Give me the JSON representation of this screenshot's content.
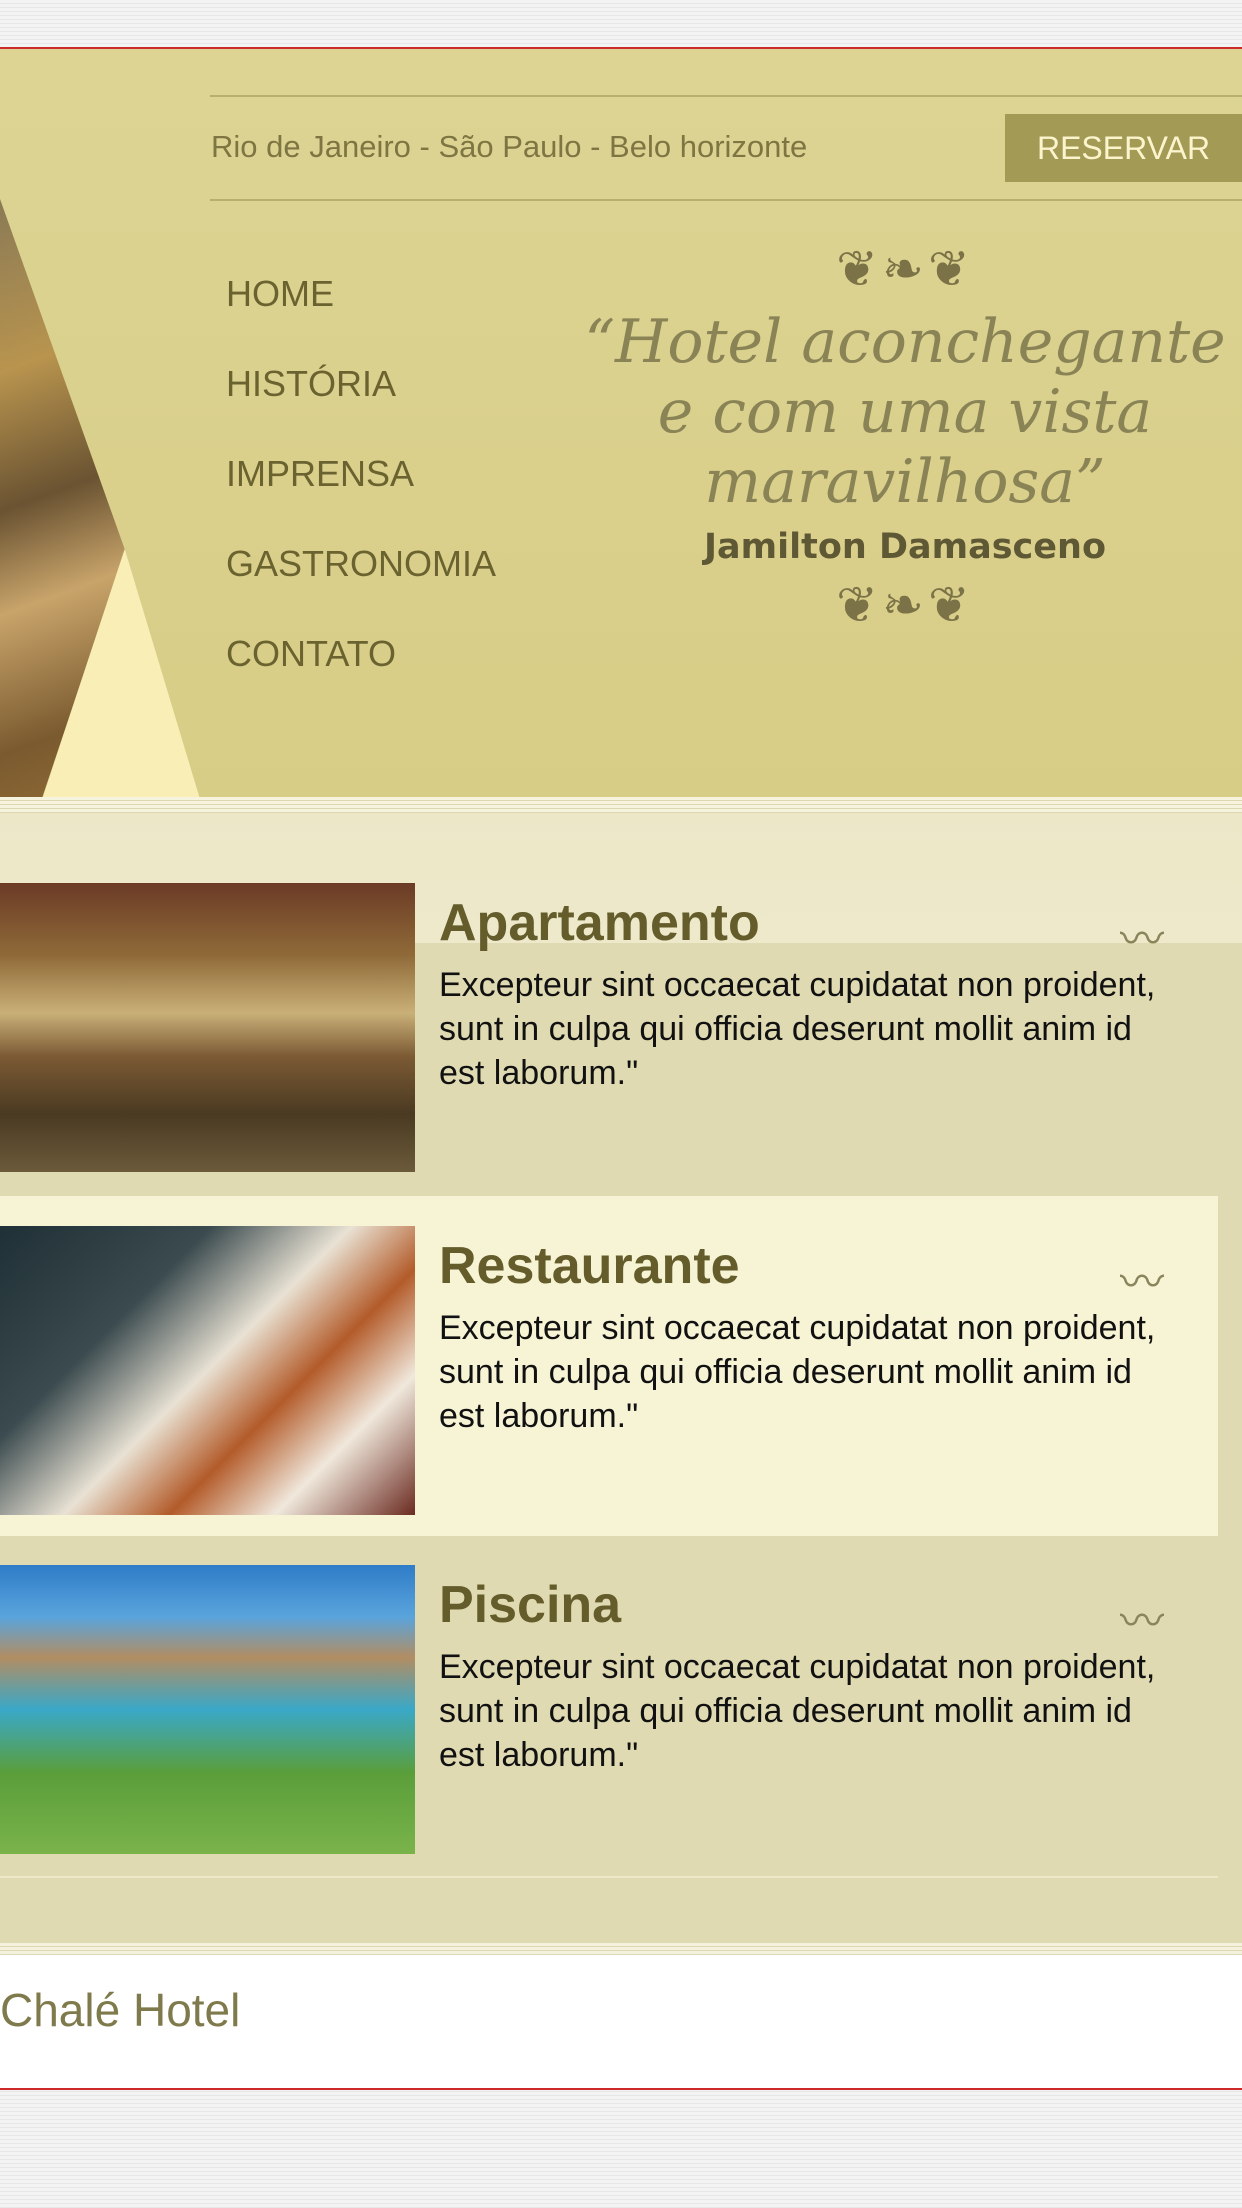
{
  "header": {
    "cities": "Rio de Janeiro - São Paulo - Belo horizonte",
    "reserve_button": "RESERVAR",
    "nav": [
      "HOME",
      "HISTÓRIA",
      "IMPRENSA",
      "GASTRONOMIA",
      "CONTATO"
    ],
    "quote": {
      "ornament_top": "❦❧❦",
      "text": "“Hotel aconchegante e com uma vista maravilhosa”",
      "author": "Jamilton Damasceno",
      "ornament_bottom": "❦❧❦"
    }
  },
  "cards": [
    {
      "title": "Apartamento",
      "description": "Excepteur sint occaecat cupidatat non proident, sunt in culpa qui officia deserunt mollit anim id est laborum.\"",
      "icon": "wave-icon"
    },
    {
      "title": "Restaurante",
      "description": "Excepteur sint occaecat cupidatat non proident, sunt in culpa qui officia deserunt mollit anim id est laborum.\"",
      "icon": "wave-icon"
    },
    {
      "title": "Piscina",
      "description": "Excepteur sint occaecat cupidatat non proident, sunt in culpa qui officia deserunt mollit anim id est laborum.\"",
      "icon": "wave-icon"
    }
  ],
  "footer": {
    "name": "Chalé Hotel"
  },
  "colors": {
    "header_bg": "#d8cd86",
    "accent_button": "#a39a55",
    "title_text": "#645c2b",
    "content_bg": "#dfdab2",
    "highlight_card": "#f7f3d5",
    "border_red": "#cc2a2a"
  }
}
